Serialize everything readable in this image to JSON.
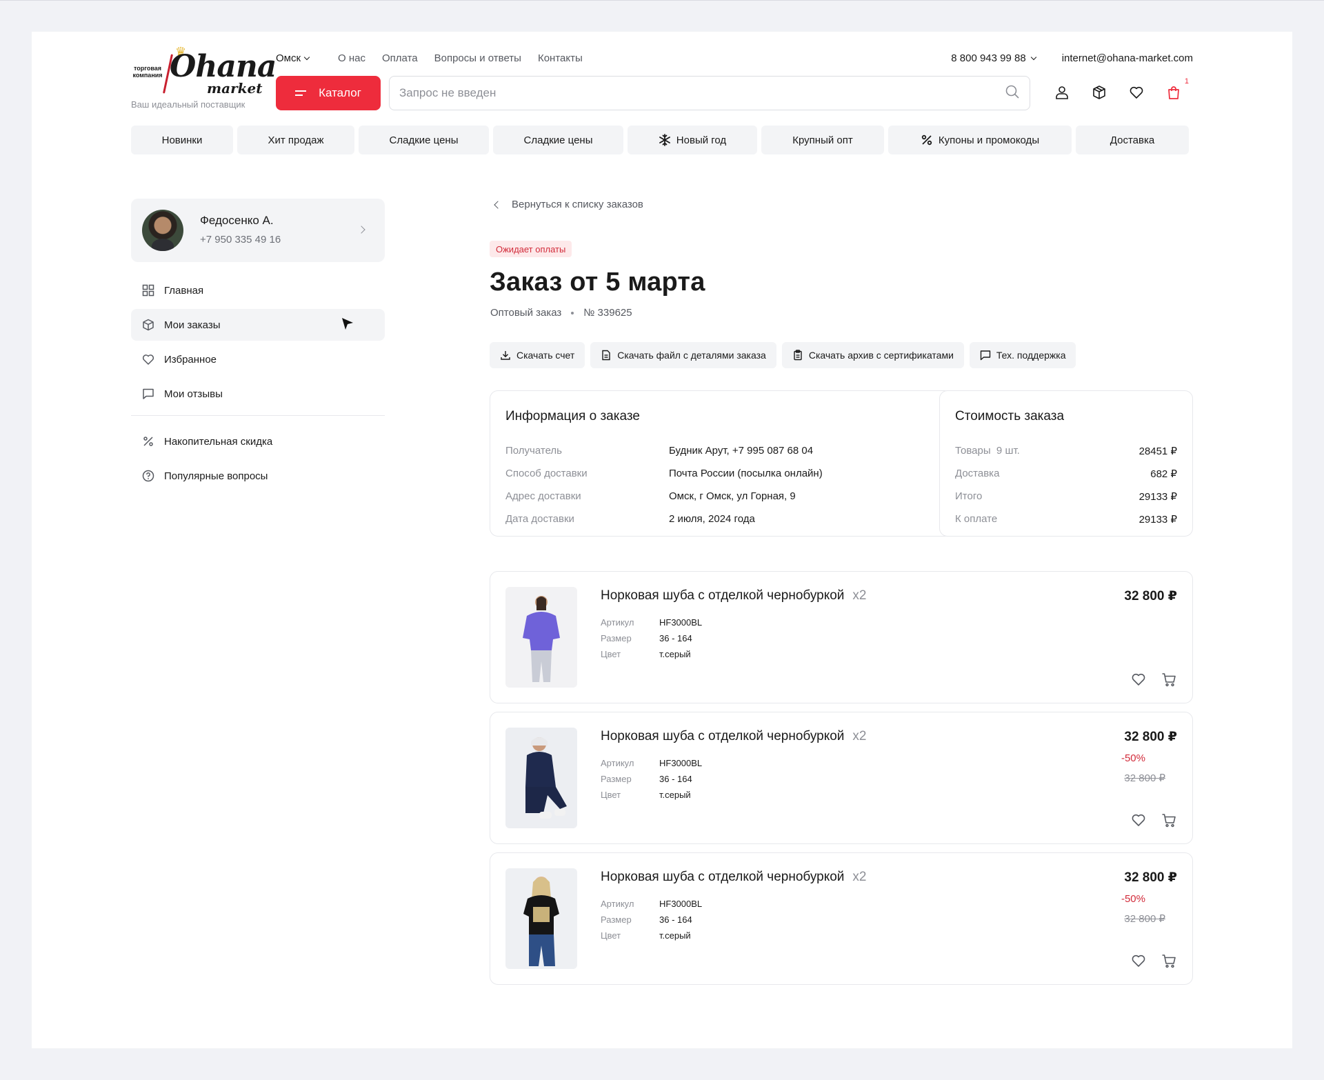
{
  "brand": {
    "logo_small": "торговая компания",
    "logo_main": "Ohana",
    "logo_sub": "market",
    "tagline": "Ваш идеальный поставщик"
  },
  "header": {
    "city": "Омск",
    "links": [
      "О нас",
      "Оплата",
      "Вопросы и ответы",
      "Контакты"
    ],
    "phone": "8 800 943 99 88",
    "email": "internet@ohana-market.com",
    "catalog_label": "Каталог",
    "search_placeholder": "Запрос не введен",
    "cart_count": "1"
  },
  "categories": [
    {
      "label": "Новинки",
      "icon": ""
    },
    {
      "label": "Хит продаж",
      "icon": ""
    },
    {
      "label": "Сладкие цены",
      "icon": ""
    },
    {
      "label": "Сладкие цены",
      "icon": ""
    },
    {
      "label": "Новый год",
      "icon": "snowflake-icon"
    },
    {
      "label": "Крупный опт",
      "icon": ""
    },
    {
      "label": "Купоны и промокоды",
      "icon": "percent-icon"
    },
    {
      "label": "Доставка",
      "icon": ""
    }
  ],
  "profile": {
    "name": "Федосенко А.",
    "phone": "+7 950 335 49 16"
  },
  "sidebar": {
    "items": [
      {
        "label": "Главная",
        "icon": "grid-icon",
        "active": false
      },
      {
        "label": "Мои заказы",
        "icon": "box-icon",
        "active": true
      },
      {
        "label": "Избранное",
        "icon": "heart-icon",
        "active": false
      },
      {
        "label": "Мои отзывы",
        "icon": "chat-icon",
        "active": false
      }
    ],
    "extra": [
      {
        "label": "Накопительная скидка",
        "icon": "percent-icon"
      },
      {
        "label": "Популярные вопросы",
        "icon": "question-icon"
      }
    ]
  },
  "order": {
    "back_label": "Вернуться к списку заказов",
    "status": "Ожидает оплаты",
    "title": "Заказ от 5 марта",
    "type": "Оптовый заказ",
    "number": "№ 339625",
    "actions": [
      {
        "label": "Скачать счет",
        "icon": "download-icon"
      },
      {
        "label": "Скачать файл с деталями заказа",
        "icon": "file-icon"
      },
      {
        "label": "Скачать архив с сертификатами",
        "icon": "clipboard-icon"
      },
      {
        "label": "Тех. поддержка",
        "icon": "chat-icon"
      }
    ],
    "info": {
      "title": "Информация о заказе",
      "rows": [
        {
          "k": "Получатель",
          "v": "Будник Арут, +7 995 087 68 04"
        },
        {
          "k": "Способ доставки",
          "v": "Почта России (посылка онлайн)"
        },
        {
          "k": "Адрес доставки",
          "v": "Омск, г Омск, ул Горная, 9"
        },
        {
          "k": "Дата доставки",
          "v": "2 июля, 2024 года"
        }
      ]
    },
    "cost": {
      "title": "Стоимость заказа",
      "rows": [
        {
          "k": "Товары  9 шт.",
          "v": "28451 ₽"
        },
        {
          "k": "Доставка",
          "v": "682 ₽"
        },
        {
          "k": "Итого",
          "v": "29133 ₽"
        },
        {
          "k": "К оплате",
          "v": "29133 ₽"
        }
      ]
    },
    "props_labels": {
      "article": "Артикул",
      "size": "Размер",
      "color": "Цвет"
    },
    "products": [
      {
        "name": "Норковая шуба с отделкой чернобуркой",
        "qty": "x2",
        "article": "HF3000BL",
        "size": "36 - 164",
        "color": "т.серый",
        "price": "32 800 ₽",
        "discount": "",
        "old_price": ""
      },
      {
        "name": "Норковая шуба с отделкой чернобуркой",
        "qty": "x2",
        "article": "HF3000BL",
        "size": "36 - 164",
        "color": "т.серый",
        "price": "32 800 ₽",
        "discount": "-50%",
        "old_price": "32 800 ₽"
      },
      {
        "name": "Норковая шуба с отделкой чернобуркой",
        "qty": "x2",
        "article": "HF3000BL",
        "size": "36 - 164",
        "color": "т.серый",
        "price": "32 800 ₽",
        "discount": "-50%",
        "old_price": "32 800 ₽"
      }
    ]
  },
  "colors": {
    "accent": "#ee2c3c",
    "status_bg": "#fde9ea",
    "status_text": "#d22b3a"
  }
}
